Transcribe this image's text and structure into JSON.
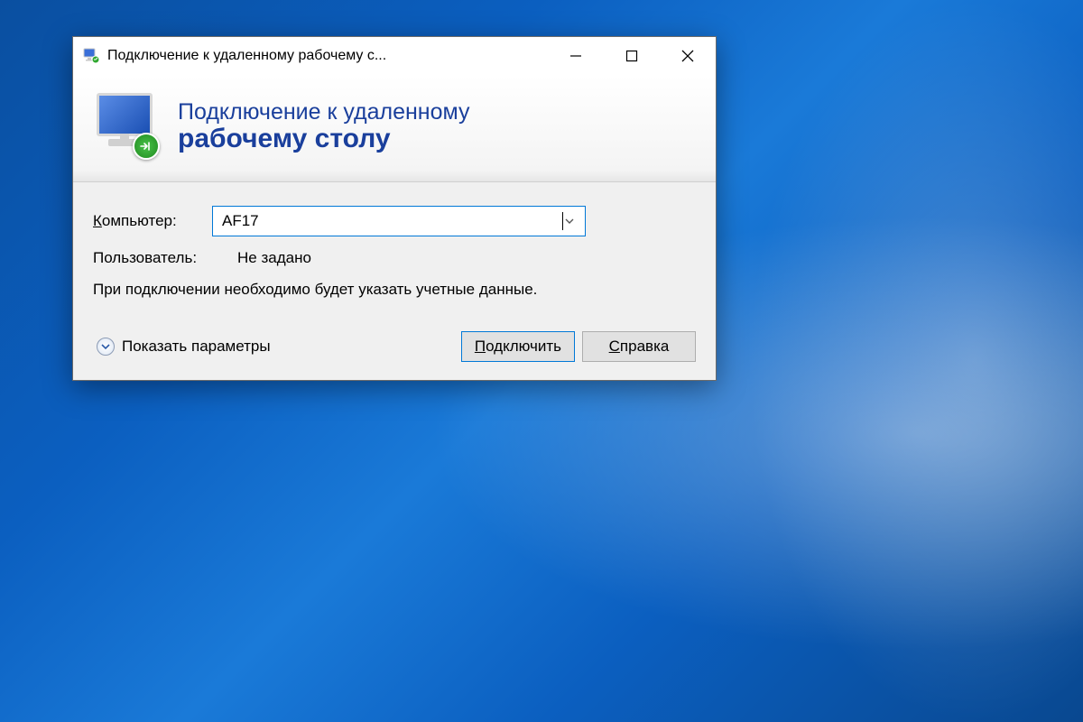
{
  "window": {
    "title": "Подключение к удаленному рабочему с..."
  },
  "banner": {
    "line1": "Подключение к удаленному",
    "line2": "рабочему столу"
  },
  "form": {
    "computer_label_prefix": "К",
    "computer_label_rest": "омпьютер:",
    "computer_value": "AF17",
    "user_label": "Пользователь:",
    "user_value": "Не задано",
    "info_text": "При подключении необходимо будет указать учетные данные."
  },
  "footer": {
    "show_options_prefix": "П",
    "show_options_rest": "оказать параметры",
    "connect_prefix": "П",
    "connect_rest": "одключить",
    "help_prefix": "С",
    "help_rest": "правка"
  }
}
